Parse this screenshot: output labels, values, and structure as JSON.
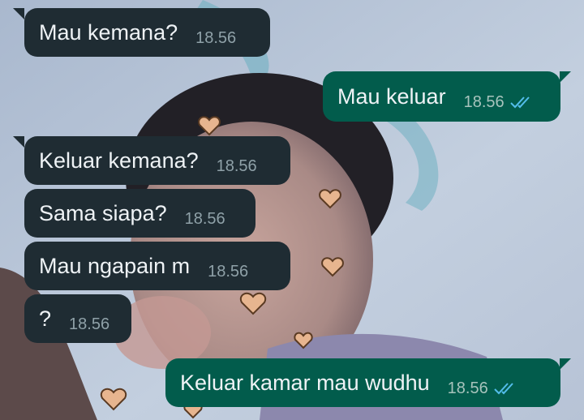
{
  "colors": {
    "incoming_bubble": "#1f2c33",
    "outgoing_bubble": "#025c4c",
    "read_ticks": "#53bdeb"
  },
  "background": {
    "icons": [
      "heart-sticker-icon"
    ]
  },
  "messages": [
    {
      "direction": "incoming",
      "text": "Mau kemana?",
      "time": "18.56"
    },
    {
      "direction": "outgoing",
      "text": "Mau keluar",
      "time": "18.56",
      "status": "read"
    },
    {
      "direction": "incoming",
      "text": "Keluar kemana?",
      "time": "18.56"
    },
    {
      "direction": "incoming",
      "text": "Sama siapa?",
      "time": "18.56"
    },
    {
      "direction": "incoming",
      "text": "Mau ngapain m",
      "time": "18.56"
    },
    {
      "direction": "incoming",
      "text": "?",
      "time": "18.56"
    },
    {
      "direction": "outgoing",
      "text": "Keluar kamar mau wudhu",
      "time": "18.56",
      "status": "read"
    }
  ]
}
